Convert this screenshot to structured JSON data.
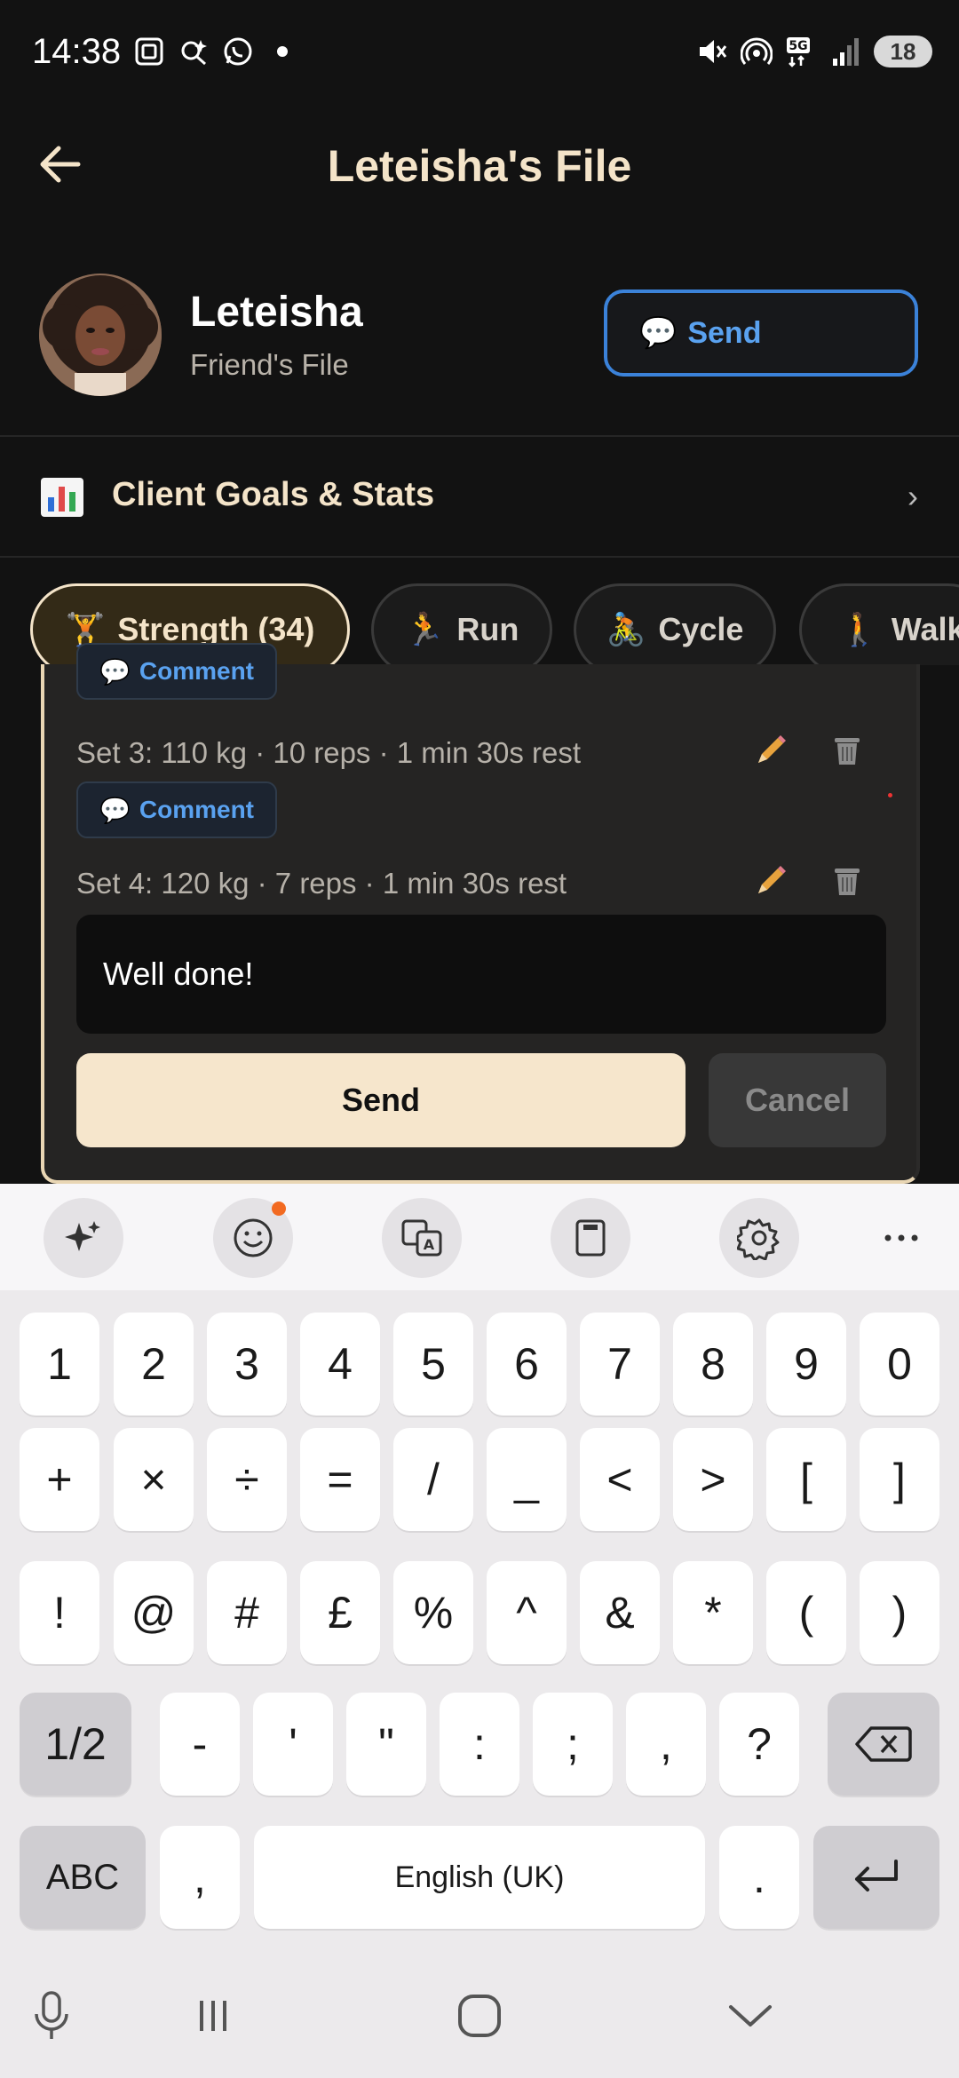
{
  "status_bar": {
    "time": "14:38",
    "battery": "18",
    "left_icons": [
      "screenshot-icon",
      "search-spark-icon",
      "whatsapp-icon",
      "dot-icon"
    ],
    "right_icons": [
      "mute-icon",
      "hotspot-icon",
      "5g-icon",
      "signal-icon"
    ]
  },
  "header": {
    "title": "Leteisha's File",
    "back_icon": "arrow-left-icon"
  },
  "profile": {
    "name": "Leteisha",
    "subtitle": "Friend's File",
    "send_button": {
      "emoji": "💬",
      "label": "Send"
    }
  },
  "goals": {
    "emoji": "📊",
    "label": "Client Goals & Stats",
    "chevron": "›"
  },
  "tabs": [
    {
      "emoji": "🏋️",
      "label": "Strength (34)",
      "active": true
    },
    {
      "emoji": "🏃",
      "label": "Run",
      "active": false
    },
    {
      "emoji": "🚴",
      "label": "Cycle",
      "active": false
    },
    {
      "emoji": "🚶",
      "label": "Walk",
      "active": false
    }
  ],
  "card": {
    "comment_chip": {
      "emoji": "💬",
      "label": "Comment"
    },
    "sets": [
      {
        "text": "Set 3: 110 kg  ·  10 reps  ·  1 min 30s rest"
      },
      {
        "text": "Set 4: 120 kg  ·  7 reps  ·  1 min 30s rest"
      }
    ],
    "comment_value": "Well done!",
    "send_label": "Send",
    "cancel_label": "Cancel",
    "edit_icon": "pencil-icon",
    "delete_icon": "trash-icon"
  },
  "keyboard": {
    "toolbar": [
      "sparkle-icon",
      "emoji-icon",
      "translate-icon",
      "clipboard-icon",
      "settings-icon",
      "more-icon"
    ],
    "row1": [
      "1",
      "2",
      "3",
      "4",
      "5",
      "6",
      "7",
      "8",
      "9",
      "0"
    ],
    "row2": [
      "+",
      "×",
      "÷",
      "=",
      "/",
      "_",
      "<",
      ">",
      "[",
      "]"
    ],
    "row3": [
      "!",
      "@",
      "#",
      "£",
      "%",
      "^",
      "&",
      "*",
      "(",
      ")"
    ],
    "row4": [
      "1/2",
      "-",
      "'",
      "\"",
      ":",
      ";",
      ",",
      "?"
    ],
    "row5": {
      "abc": "ABC",
      "comma": ",",
      "space": "English (UK)",
      "period": "."
    }
  },
  "colors": {
    "accent_cream": "#f4e4c9",
    "accent_blue": "#3b82d9",
    "background": "#121212"
  }
}
